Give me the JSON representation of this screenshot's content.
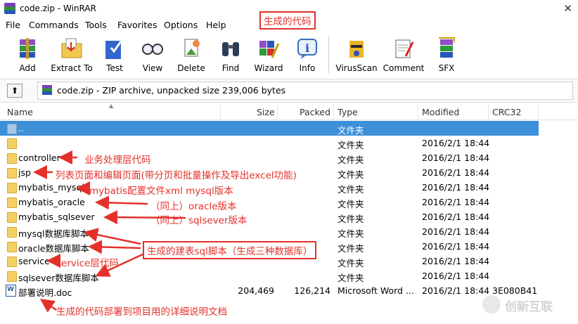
{
  "window": {
    "title": "code.zip - WinRAR",
    "close": "✕"
  },
  "menu": [
    "File",
    "Commands",
    "Tools",
    "Favorites",
    "Options",
    "Help"
  ],
  "toolbar": [
    "Add",
    "Extract To",
    "Test",
    "View",
    "Delete",
    "Find",
    "Wizard",
    "Info",
    "VirusScan",
    "Comment",
    "SFX"
  ],
  "address": {
    "up": "⬆",
    "text": "code.zip - ZIP archive, unpacked size 239,006 bytes"
  },
  "columns": [
    "Name",
    "Size",
    "Packed",
    "Type",
    "Modified",
    "CRC32"
  ],
  "files": [
    {
      "name": "..",
      "size": "",
      "packed": "",
      "type": "文件夹",
      "modified": "",
      "crc": "",
      "icon": "folder-up"
    },
    {
      "name": "",
      "size": "",
      "packed": "",
      "type": "文件夹",
      "modified": "2016/2/1 18:44",
      "crc": "",
      "icon": "folder"
    },
    {
      "name": "controller",
      "size": "",
      "packed": "",
      "type": "文件夹",
      "modified": "2016/2/1 18:44",
      "crc": "",
      "icon": "folder"
    },
    {
      "name": "jsp",
      "size": "",
      "packed": "",
      "type": "文件夹",
      "modified": "2016/2/1 18:44",
      "crc": "",
      "icon": "folder"
    },
    {
      "name": "mybatis_mysql",
      "size": "",
      "packed": "",
      "type": "文件夹",
      "modified": "2016/2/1 18:44",
      "crc": "",
      "icon": "folder"
    },
    {
      "name": "mybatis_oracle",
      "size": "",
      "packed": "",
      "type": "文件夹",
      "modified": "2016/2/1 18:44",
      "crc": "",
      "icon": "folder"
    },
    {
      "name": "mybatis_sqlsever",
      "size": "",
      "packed": "",
      "type": "文件夹",
      "modified": "2016/2/1 18:44",
      "crc": "",
      "icon": "folder"
    },
    {
      "name": "mysql数据库脚本",
      "size": "",
      "packed": "",
      "type": "文件夹",
      "modified": "2016/2/1 18:44",
      "crc": "",
      "icon": "folder"
    },
    {
      "name": "oracle数据库脚本",
      "size": "",
      "packed": "",
      "type": "文件夹",
      "modified": "2016/2/1 18:44",
      "crc": "",
      "icon": "folder"
    },
    {
      "name": "service",
      "size": "",
      "packed": "",
      "type": "文件夹",
      "modified": "2016/2/1 18:44",
      "crc": "",
      "icon": "folder"
    },
    {
      "name": "sqlsever数据库脚本",
      "size": "",
      "packed": "",
      "type": "文件夹",
      "modified": "2016/2/1 18:44",
      "crc": "",
      "icon": "folder"
    },
    {
      "name": "部署说明.doc",
      "size": "204,469",
      "packed": "126,214",
      "type": "Microsoft Word ...",
      "modified": "2016/2/1 18:44",
      "crc": "3E080B41",
      "icon": "doc"
    }
  ],
  "annotations": {
    "top_box": "生成的代码",
    "controller": "业务处理层代码",
    "jsp": "列表页面和编辑页面(带分页和批量操作及导出excel功能)",
    "mysql": "mybatis配置文件xml  mysql版本",
    "oracle": "（同上）oracle版本",
    "sqlsever": "（同上）sqlsever版本",
    "sql_box": "生成的建表sql脚本（生成三种数据库）",
    "service": "service层代码",
    "doc": "生成的代码部署到项目用的详细说明文档"
  },
  "watermark": "创新互联",
  "colors": {
    "annotation": "#e4302a",
    "selection": "#3d8fd8"
  }
}
